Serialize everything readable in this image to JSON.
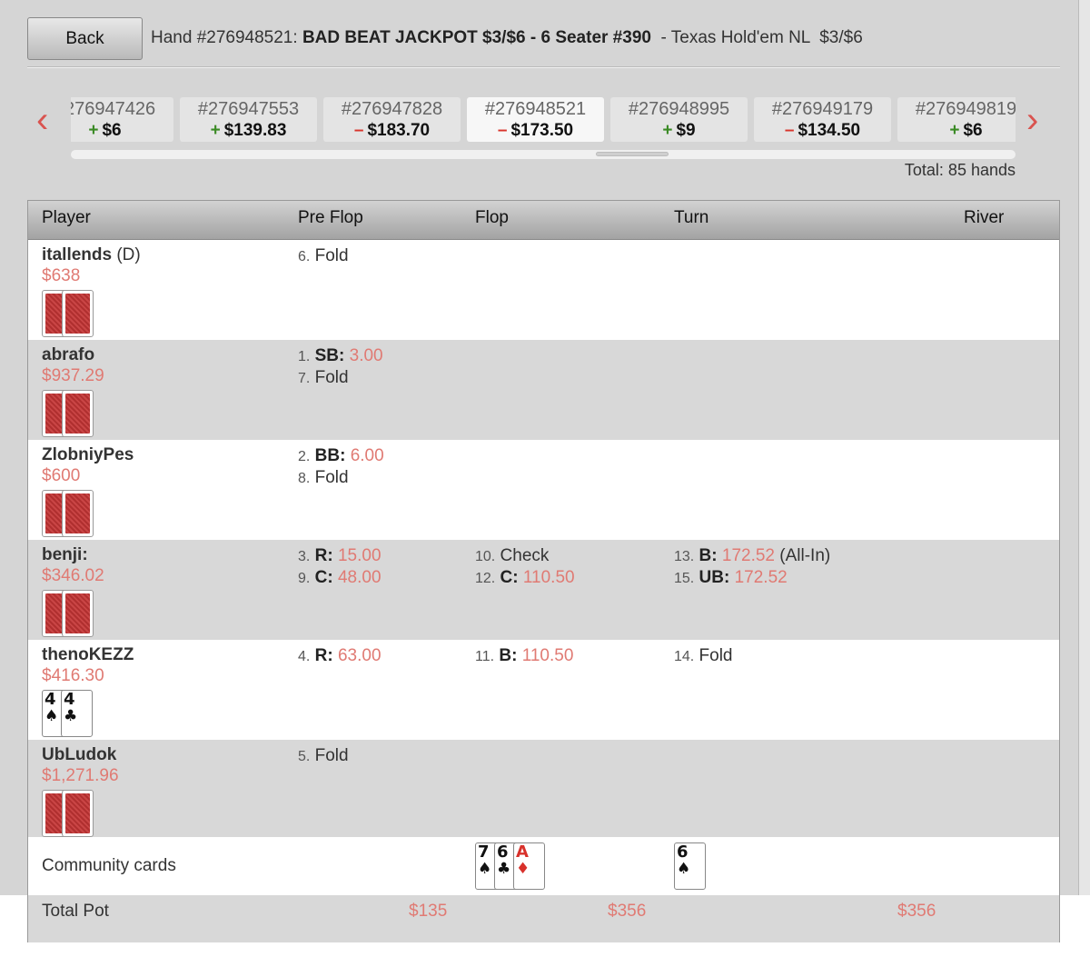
{
  "header": {
    "back_label": "Back",
    "title_prefix": "Hand #276948521: ",
    "title_bold": "BAD BEAT JACKPOT $3/$6 - 6 Seater #390",
    "title_suffix": "  - Texas Hold'em NL  $3/$6"
  },
  "hand_strip": {
    "hands": [
      {
        "id": "#276947426",
        "sign": "+",
        "amount": "$6"
      },
      {
        "id": "#276947553",
        "sign": "+",
        "amount": "$139.83"
      },
      {
        "id": "#276947828",
        "sign": "–",
        "amount": "$183.70"
      },
      {
        "id": "#276948521",
        "sign": "–",
        "amount": "$173.50"
      },
      {
        "id": "#276948995",
        "sign": "+",
        "amount": "$9"
      },
      {
        "id": "#276949179",
        "sign": "–",
        "amount": "$134.50"
      },
      {
        "id": "#276949819",
        "sign": "+",
        "amount": "$6"
      }
    ],
    "active_index": 3,
    "total_label": "Total: 85 hands",
    "prev_icon": "chevron-left-icon",
    "next_icon": "chevron-right-icon",
    "colors": {
      "plus": "#3a8a24",
      "minus": "#d9342b",
      "arrow": "#d9534f"
    }
  },
  "table": {
    "headers": {
      "player": "Player",
      "preflop": "Pre Flop",
      "flop": "Flop",
      "turn": "Turn",
      "river": "River"
    },
    "players": [
      {
        "name": "itallends",
        "dealer": " (D)",
        "stack": "$638",
        "cards": null,
        "preflop": [
          {
            "n": "6.",
            "kind": "",
            "text": "Fold",
            "amt": "",
            "extra": ""
          }
        ],
        "flop": [],
        "turn": []
      },
      {
        "name": "abrafo",
        "dealer": "",
        "stack": "$937.29",
        "cards": null,
        "preflop": [
          {
            "n": "1.",
            "kind": "SB:",
            "text": "",
            "amt": "3.00",
            "extra": ""
          },
          {
            "n": "7.",
            "kind": "",
            "text": "Fold",
            "amt": "",
            "extra": ""
          }
        ],
        "flop": [],
        "turn": []
      },
      {
        "name": "ZlobniyPes",
        "dealer": "",
        "stack": "$600",
        "cards": null,
        "preflop": [
          {
            "n": "2.",
            "kind": "BB:",
            "text": "",
            "amt": "6.00",
            "extra": ""
          },
          {
            "n": "8.",
            "kind": "",
            "text": "Fold",
            "amt": "",
            "extra": ""
          }
        ],
        "flop": [],
        "turn": []
      },
      {
        "name": "benji:",
        "dealer": "",
        "stack": "$346.02",
        "cards": null,
        "preflop": [
          {
            "n": "3.",
            "kind": "R:",
            "text": "",
            "amt": "15.00",
            "extra": ""
          },
          {
            "n": "9.",
            "kind": "C:",
            "text": "",
            "amt": "48.00",
            "extra": ""
          }
        ],
        "flop": [
          {
            "n": "10.",
            "kind": "",
            "text": "Check",
            "amt": "",
            "extra": ""
          },
          {
            "n": "12.",
            "kind": "C:",
            "text": "",
            "amt": "110.50",
            "extra": ""
          }
        ],
        "turn": [
          {
            "n": "13.",
            "kind": "B:",
            "text": "",
            "amt": "172.52",
            "extra": " (All-In)"
          },
          {
            "n": "15.",
            "kind": "UB:",
            "text": "",
            "amt": "172.52",
            "extra": ""
          }
        ]
      },
      {
        "name": "thenoKEZZ",
        "dealer": "",
        "stack": "$416.30",
        "cards": [
          {
            "rank": "4",
            "suit": "♠",
            "color": "black"
          },
          {
            "rank": "4",
            "suit": "♣",
            "color": "black"
          }
        ],
        "preflop": [
          {
            "n": "4.",
            "kind": "R:",
            "text": "",
            "amt": "63.00",
            "extra": ""
          }
        ],
        "flop": [
          {
            "n": "11.",
            "kind": "B:",
            "text": "",
            "amt": "110.50",
            "extra": ""
          }
        ],
        "turn": [
          {
            "n": "14.",
            "kind": "",
            "text": "Fold",
            "amt": "",
            "extra": ""
          }
        ]
      },
      {
        "name": "UbLudok",
        "dealer": "",
        "stack": "$1,271.96",
        "cards": null,
        "preflop": [
          {
            "n": "5.",
            "kind": "",
            "text": "Fold",
            "amt": "",
            "extra": ""
          }
        ],
        "flop": [],
        "turn": []
      }
    ],
    "community": {
      "label": "Community cards",
      "flop": [
        {
          "rank": "7",
          "suit": "♠",
          "color": "black"
        },
        {
          "rank": "6",
          "suit": "♣",
          "color": "black"
        },
        {
          "rank": "A",
          "suit": "♦",
          "color": "red"
        }
      ],
      "turn": [
        {
          "rank": "6",
          "suit": "♠",
          "color": "black"
        }
      ]
    },
    "pot": {
      "label": "Total Pot",
      "preflop": "$135",
      "flop": "$356",
      "turn": "$356"
    }
  }
}
